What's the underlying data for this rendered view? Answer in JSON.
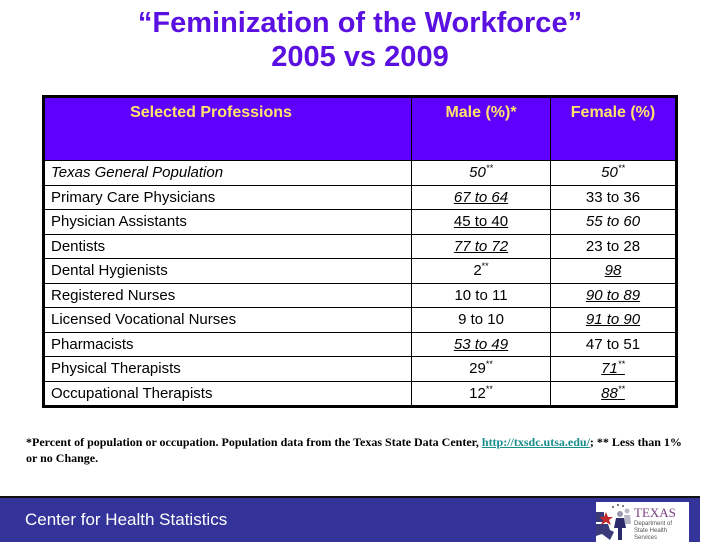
{
  "title": {
    "line1": "“Feminization of the Workforce”",
    "line2": "2005 vs 2009"
  },
  "table": {
    "headers": {
      "profession": "Selected Professions",
      "male": "Male (%)*",
      "female": "Female (%)"
    },
    "rows": [
      {
        "profession": "Texas General Population",
        "male": "50",
        "male_sup": "**",
        "female": "50",
        "female_sup": "**"
      },
      {
        "profession": "Primary Care Physicians",
        "male": "67 to 64",
        "male_sup": "",
        "female": "33 to 36",
        "female_sup": ""
      },
      {
        "profession": "Physician Assistants",
        "male": "45 to 40",
        "male_sup": "",
        "female": "55 to 60",
        "female_sup": ""
      },
      {
        "profession": "Dentists",
        "male": "77 to 72",
        "male_sup": "",
        "female": "23 to 28",
        "female_sup": ""
      },
      {
        "profession": "Dental Hygienists",
        "male": "2",
        "male_sup": "**",
        "female": "98",
        "female_sup": ""
      },
      {
        "profession": "Registered Nurses",
        "male": "10 to 11",
        "male_sup": "",
        "female": "90 to 89",
        "female_sup": ""
      },
      {
        "profession": "Licensed Vocational Nurses",
        "male": "9 to 10",
        "male_sup": "",
        "female": "91 to 90",
        "female_sup": ""
      },
      {
        "profession": "Pharmacists",
        "male": "53 to 49",
        "male_sup": "",
        "female": "47 to 51",
        "female_sup": ""
      },
      {
        "profession": "Physical Therapists",
        "male": "29",
        "male_sup": "**",
        "female": "71",
        "female_sup": "**"
      },
      {
        "profession": "Occupational Therapists",
        "male": "12",
        "male_sup": "**",
        "female": "88",
        "female_sup": "**"
      }
    ]
  },
  "footnote": {
    "text_before_link": "*Percent of population or occupation.  Population data from the Texas State Data Center, ",
    "link": "http://txsdc.utsa.edu/",
    "text_after_link": ";  ** Less than 1% or no Change."
  },
  "footer": {
    "label": "Center for Health Statistics",
    "logo_word": "TEXAS",
    "logo_sub_line1": "Department of",
    "logo_sub_line2": "State Health Services"
  },
  "colors": {
    "title": "#5a10e0",
    "header_bg": "#5f00ff",
    "header_text": "#ffe46a",
    "footer_bg": "#333399",
    "link": "#1a8c8c"
  }
}
